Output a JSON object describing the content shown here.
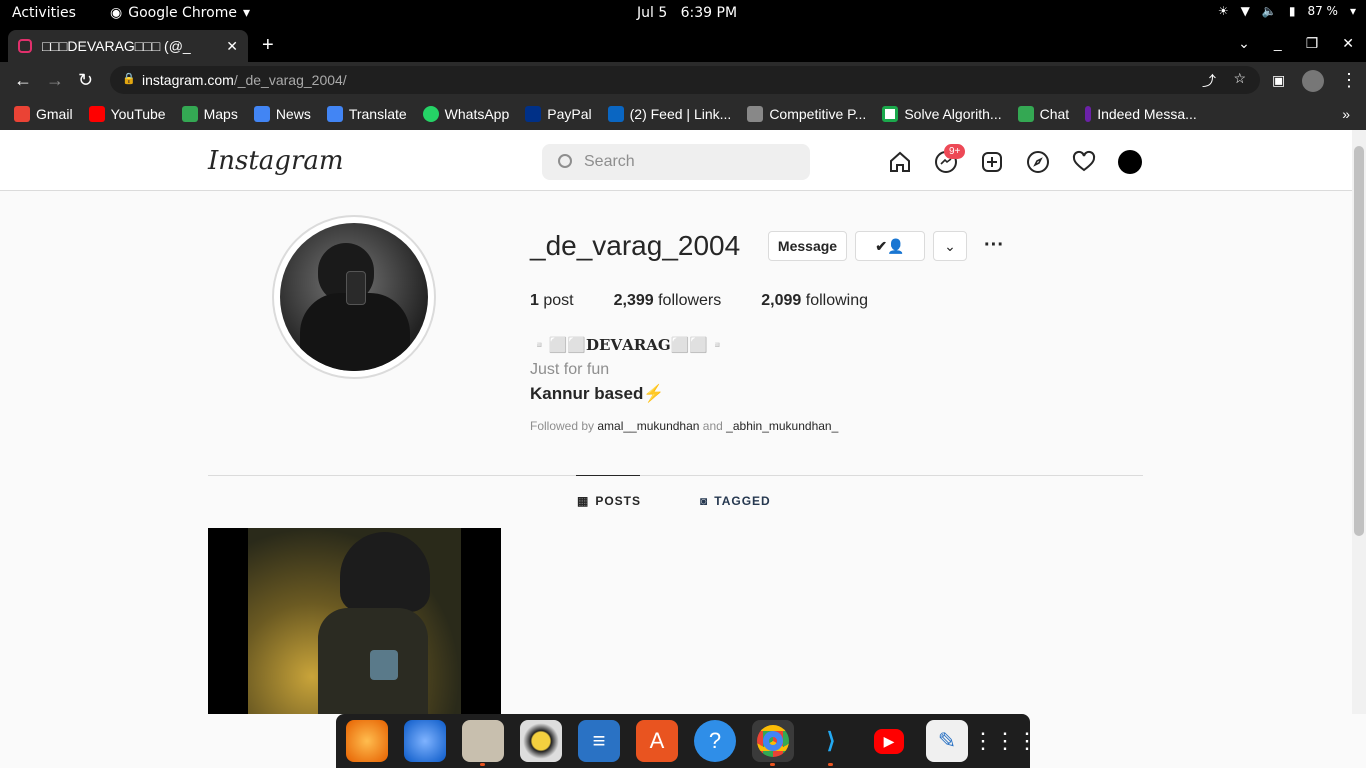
{
  "os": {
    "activities": "Activities",
    "app_name": "Google Chrome",
    "date": "Jul 5",
    "time": "6:39 PM",
    "battery": "87 %"
  },
  "browser": {
    "tab_title": "□□□DEVARAG□□□ (@_",
    "url_host": "instagram.com",
    "url_path": "/_de_varag_2004/",
    "bookmarks": [
      {
        "label": "Gmail",
        "color": "#ea4335"
      },
      {
        "label": "YouTube",
        "color": "#ff0000"
      },
      {
        "label": "Maps",
        "color": "#34a853"
      },
      {
        "label": "News",
        "color": "#4285f4"
      },
      {
        "label": "Translate",
        "color": "#4285f4"
      },
      {
        "label": "WhatsApp",
        "color": "#25d366"
      },
      {
        "label": "PayPal",
        "color": "#003087"
      },
      {
        "label": "(2) Feed | Link...",
        "color": "#0a66c2"
      },
      {
        "label": "Competitive P...",
        "color": "#888888"
      },
      {
        "label": "Solve Algorith...",
        "color": "#000000"
      },
      {
        "label": "Chat",
        "color": "#34a853"
      },
      {
        "label": "Indeed Messa...",
        "color": "#6b21a8"
      }
    ]
  },
  "instagram": {
    "logo": "Instagram",
    "search_placeholder": "Search",
    "messages_badge": "9+",
    "profile": {
      "username": "_de_varag_2004",
      "message_button": "Message",
      "posts_count": "1",
      "posts_label": "post",
      "followers_count": "2,399",
      "followers_label": "followers",
      "following_count": "2,099",
      "following_label": "following",
      "display_name": "▫️⬜⬜𝐃𝐄𝐕𝐀𝐑𝐀𝐆⬜⬜▫️",
      "bio_line1": "Just for fun",
      "bio_line2": "Kannur based⚡",
      "followed_by_prefix": "Followed by",
      "followed_user1": "amal__mukundhan",
      "followed_and": "and",
      "followed_user2": "_abhin_mukundhan_"
    },
    "tabs": {
      "posts": "POSTS",
      "tagged": "TAGGED"
    }
  }
}
